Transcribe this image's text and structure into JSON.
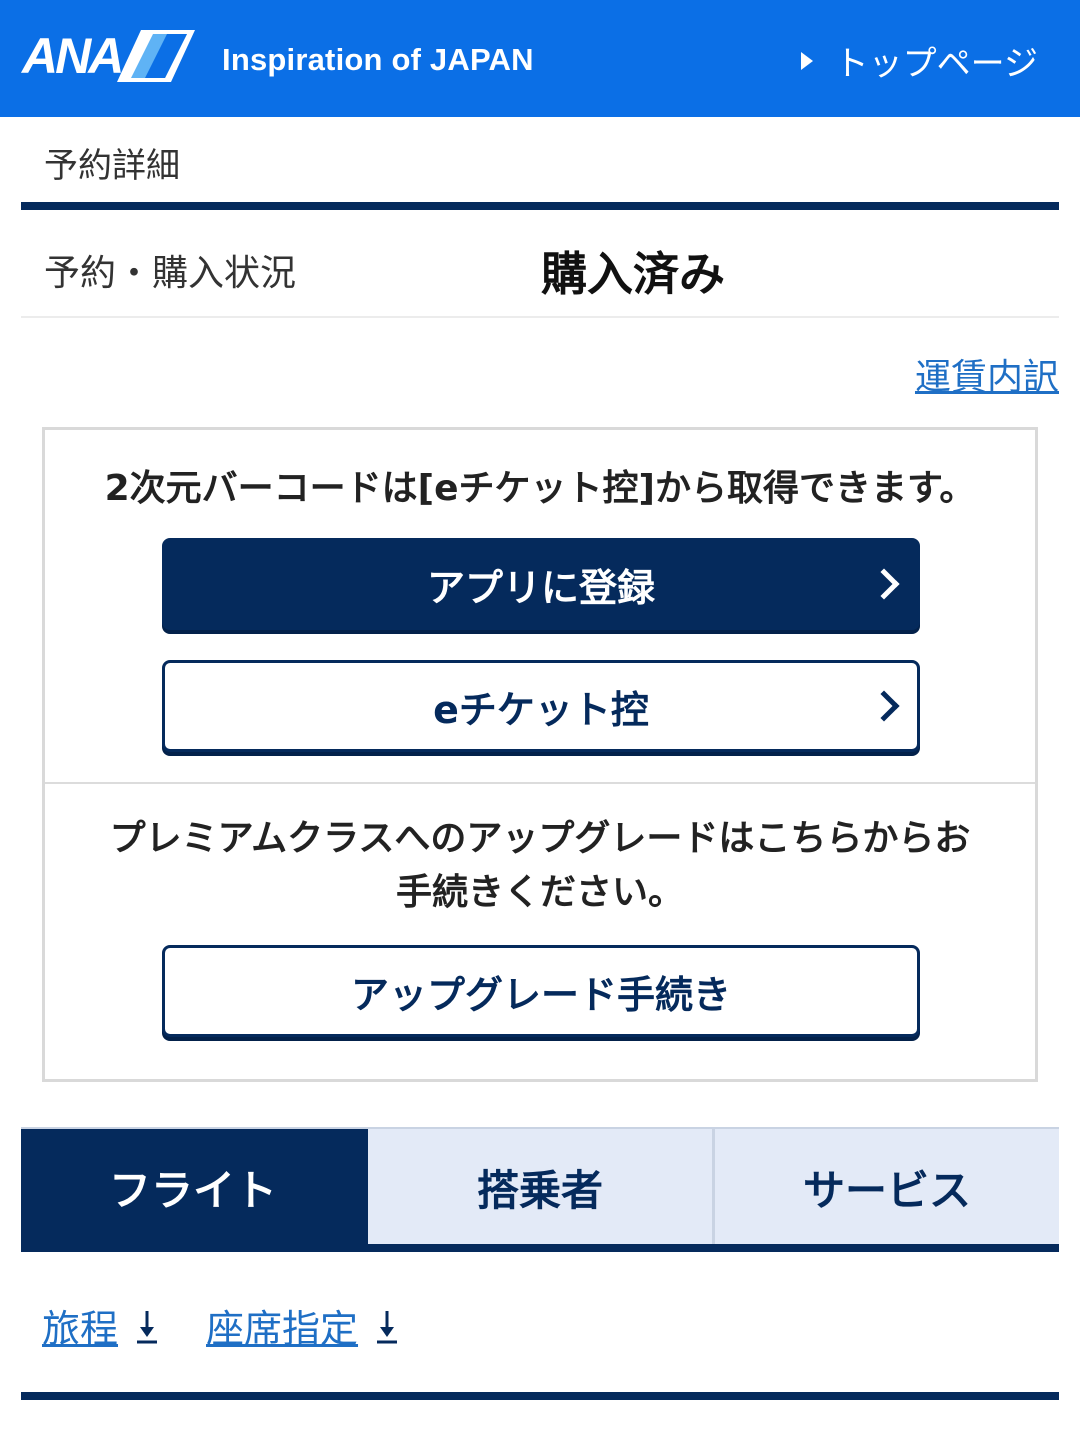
{
  "header": {
    "logo_text": "ANA",
    "tagline": "Inspiration of JAPAN",
    "top_link": "トップページ"
  },
  "page_label": "予約詳細",
  "status": {
    "label": "予約・購入状況",
    "value": "購入済み"
  },
  "fare_link": "運賃内訳",
  "panel": {
    "barcode_text": "2次元バーコードは[eチケット控]から取得できます。",
    "app_button": "アプリに登録",
    "eticket_button": "eチケット控",
    "upgrade_text_line1": "プレミアムクラスへのアップグレードはこちらからお",
    "upgrade_text_line2": "手続きください。",
    "upgrade_button": "アップグレード手続き"
  },
  "tabs": [
    {
      "label": "フライト",
      "active": true
    },
    {
      "label": "搭乗者",
      "active": false
    },
    {
      "label": "サービス",
      "active": false
    }
  ],
  "anchors": [
    {
      "label": "旅程"
    },
    {
      "label": "座席指定"
    }
  ],
  "colors": {
    "header_blue": "#0b6fe6",
    "navy": "#052a5c",
    "link_blue": "#1f6fc5",
    "tab_inactive": "#e3eaf7"
  }
}
